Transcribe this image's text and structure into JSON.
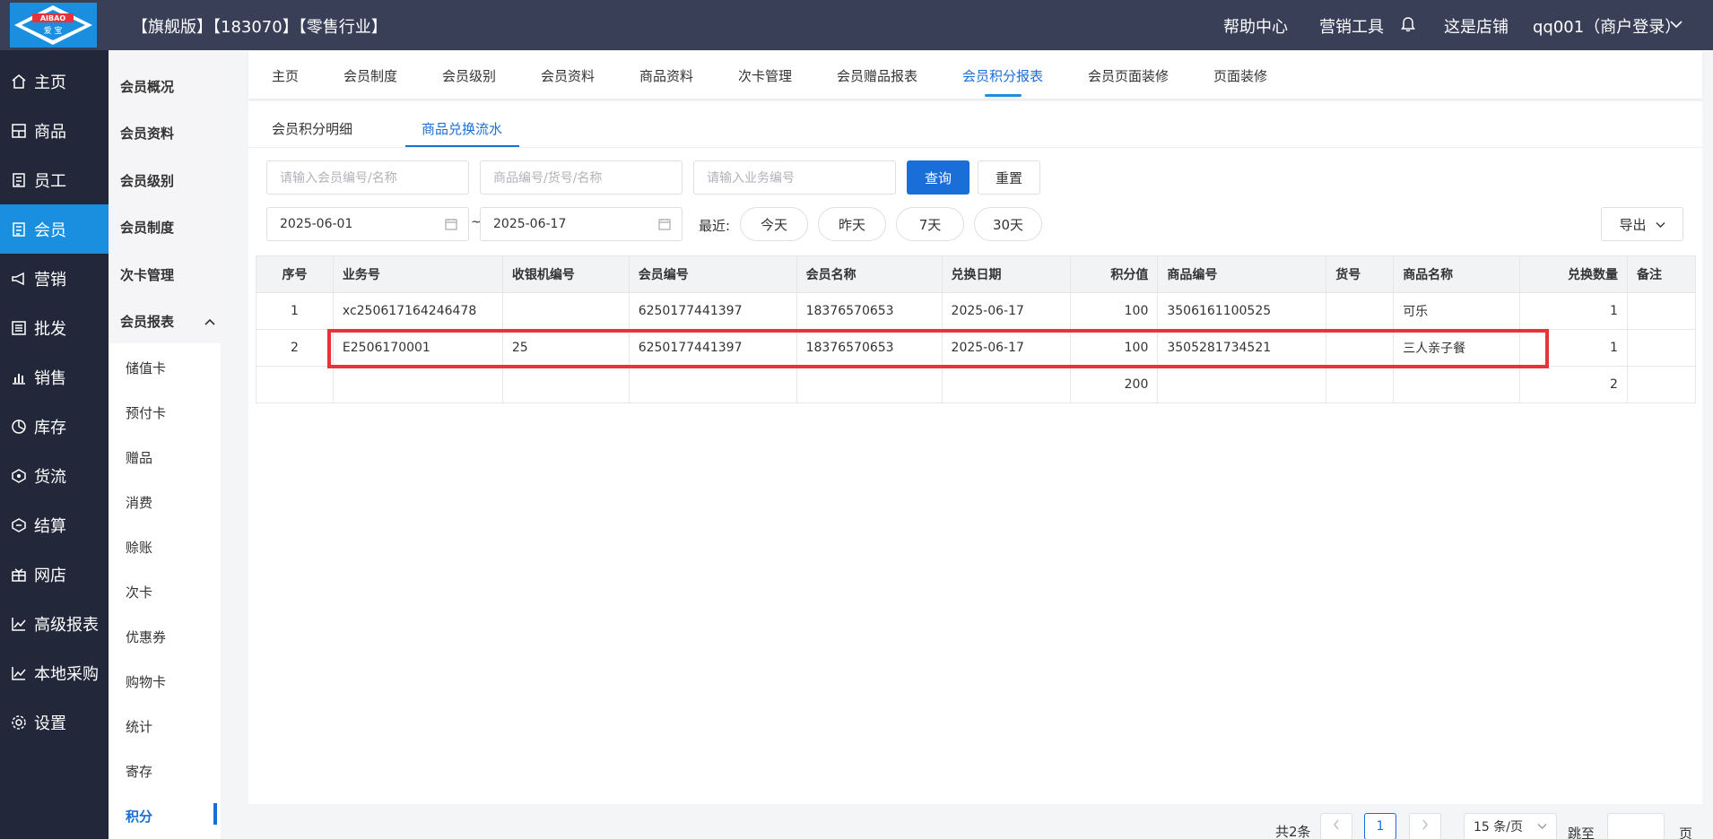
{
  "header": {
    "logo_text": "AIBAO",
    "logo_sub": "爱宝",
    "shop_title": "【旗舰版】【183070】【零售行业】",
    "nav": [
      "帮助中心",
      "营销工具",
      "这是店铺",
      "qq001（商户登录）"
    ],
    "bg_color": "#3a3f58"
  },
  "sidebar": {
    "items": [
      {
        "label": "主页",
        "icon": "home-icon"
      },
      {
        "label": "商品",
        "icon": "goods-icon"
      },
      {
        "label": "员工",
        "icon": "staff-icon"
      },
      {
        "label": "会员",
        "icon": "member-icon"
      },
      {
        "label": "营销",
        "icon": "megaphone-icon"
      },
      {
        "label": "批发",
        "icon": "wholesale-icon"
      },
      {
        "label": "销售",
        "icon": "bar-chart-icon"
      },
      {
        "label": "库存",
        "icon": "pie-icon"
      },
      {
        "label": "货流",
        "icon": "flow-icon"
      },
      {
        "label": "结算",
        "icon": "settle-icon"
      },
      {
        "label": "网店",
        "icon": "gift-icon"
      },
      {
        "label": "高级报表",
        "icon": "line-chart-icon"
      },
      {
        "label": "本地采购",
        "icon": "line-chart-icon"
      },
      {
        "label": "设置",
        "icon": "gear-icon"
      }
    ],
    "active": "会员",
    "active_color": "#1a8fe0"
  },
  "subnav": {
    "items": [
      "会员概况",
      "会员资料",
      "会员级别",
      "会员制度",
      "次卡管理",
      "会员报表"
    ],
    "report_children": [
      "储值卡",
      "预付卡",
      "赠品",
      "消费",
      "赊账",
      "次卡",
      "优惠券",
      "购物卡",
      "统计",
      "寄存",
      "积分"
    ],
    "active": "积分"
  },
  "tabs": {
    "items": [
      "主页",
      "会员制度",
      "会员级别",
      "会员资料",
      "商品资料",
      "次卡管理",
      "会员赠品报表",
      "会员积分报表",
      "会员页面装修",
      "页面装修"
    ],
    "active": "会员积分报表"
  },
  "subtabs": {
    "items": [
      "会员积分明细",
      "商品兑换流水"
    ],
    "active": "商品兑换流水"
  },
  "filters": {
    "member_placeholder": "请输入会员编号/名称",
    "goods_placeholder": "商品编号/货号/名称",
    "biz_placeholder": "请输入业务编号",
    "query_label": "查询",
    "reset_label": "重置",
    "date_from": "2025-06-01",
    "date_sep": "~",
    "date_to": "2025-06-17",
    "recent_label": "最近:",
    "quick": [
      "今天",
      "昨天",
      "7天",
      "30天"
    ],
    "export_label": "导出"
  },
  "table": {
    "columns": [
      "序号",
      "业务号",
      "收银机编号",
      "会员编号",
      "会员名称",
      "兑换日期",
      "积分值",
      "商品编号",
      "货号",
      "商品名称",
      "兑换数量",
      "备注"
    ],
    "rows": [
      [
        "1",
        "xc250617164246478",
        "",
        "6250177441397",
        "18376570653",
        "2025-06-17",
        "100",
        "3506161100525",
        "",
        "可乐",
        "1",
        ""
      ],
      [
        "2",
        "E2506170001",
        "25",
        "6250177441397",
        "18376570653",
        "2025-06-17",
        "100",
        "3505281734521",
        "",
        "三人亲子餐",
        "1",
        ""
      ]
    ],
    "total_row": [
      "",
      "",
      "",
      "",
      "",
      "",
      "200",
      "",
      "",
      "",
      "2",
      ""
    ]
  },
  "pagination": {
    "total": "共2条",
    "current_page": "1",
    "page_size": "15 条/页",
    "jump_label": "跳至",
    "page_unit": "页"
  }
}
